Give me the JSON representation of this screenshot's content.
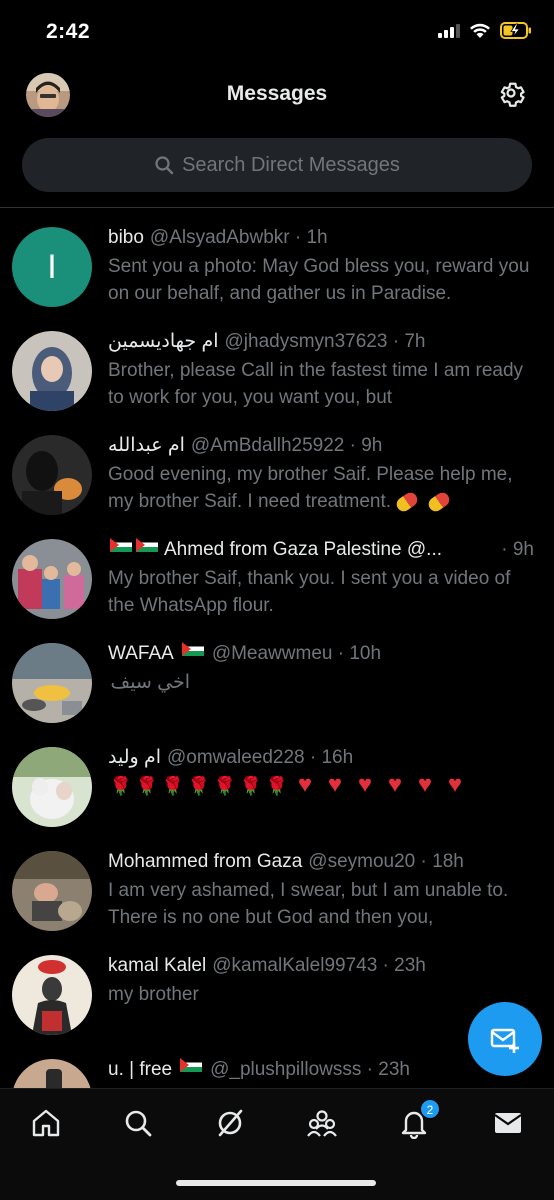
{
  "status_bar": {
    "time": "2:42"
  },
  "header": {
    "title": "Messages"
  },
  "search": {
    "placeholder": "Search Direct Messages"
  },
  "conversations": [
    {
      "name": "bibo",
      "handle": "@AlsyadAbwbkr · 1h",
      "message": "Sent you a photo: May God bless you, reward you on our behalf, and gather us in Paradise.",
      "avatar_initial": "I",
      "avatar_color": "#1a8f7a"
    },
    {
      "name": "ام جهاديسمين",
      "handle": "@jhadysmyn37623 · 7h",
      "message": "Brother, please Call in the fastest time I am ready to work for you, you want you, but"
    },
    {
      "name": "ام عبدالله",
      "handle": "@AmBdallh25922 · 9h",
      "message": "Good evening, my brother Saif. Please help me, my brother Saif. I need treatment."
    },
    {
      "name": "Ahmed from Gaza Palestine @...",
      "handle": "· 9h",
      "message": "My brother Saif, thank you. I sent you a video of the WhatsApp flour."
    },
    {
      "name": "WAFAA",
      "handle": "@Meawwmeu · 10h",
      "message": "اخي سيف"
    },
    {
      "name": "ام وليد",
      "handle": "@omwaleed228 · 16h",
      "message": ""
    },
    {
      "name": "Mohammed from Gaza",
      "handle": "@seymou20 · 18h",
      "message": "I am very ashamed, I swear, but I am unable to. There is no one but God and then you,"
    },
    {
      "name": "kamal Kalel",
      "handle": "@kamalKalel99743 · 23h",
      "message": "my brother"
    },
    {
      "name": "u. | free",
      "handle": "@_plushpillowsss · 23h",
      "message": ""
    }
  ],
  "tabbar": {
    "notifications_badge": "2"
  },
  "colors": {
    "accent": "#1d9bf0",
    "background": "#000000",
    "secondary_text": "#71767b"
  }
}
